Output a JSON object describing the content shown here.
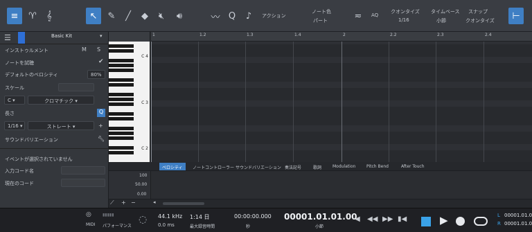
{
  "toolbar": {
    "action_label": "アクション",
    "note_color_label": "ノート色",
    "note_color_value": "パート",
    "aq_label": "AQ",
    "quantize_label": "クオンタイズ",
    "quantize_value": "1/16",
    "timebase_label": "タイムベース",
    "timebase_value": "小節",
    "snap_label": "スナップ",
    "snap_value": "クオンタイズ"
  },
  "left": {
    "kit_name": "Basic Kit",
    "instrument_label": "インストゥルメント",
    "m_label": "M",
    "s_label": "S",
    "audition_label": "ノートを試聴",
    "default_velocity_label": "デフォルトのベロシティ",
    "default_velocity_value": "80%",
    "scale_label": "スケール",
    "key_value": "C",
    "scale_value": "クロマチック",
    "length_label": "長さ",
    "length_value": "1/16",
    "length_mode": "ストレート",
    "sound_variation_label": "サウンドバリエーション",
    "no_event_label": "イベントが選択されていません",
    "input_chord_label": "入力コード名",
    "current_chord_label": "現在のコード"
  },
  "piano": {
    "c4": "C 4",
    "c3": "C 3",
    "c2": "C 2"
  },
  "ruler": {
    "ticks": [
      "1",
      "1.2",
      "1.3",
      "1.4",
      "2",
      "2.2",
      "2.3",
      "2.4"
    ]
  },
  "tabs": [
    "ベロシティ",
    "ノートコントローラー",
    "サウンドバリエーション",
    "奏法記号",
    "歌詞",
    "Modulation",
    "Pitch Bend",
    "After Touch"
  ],
  "velocity": {
    "v100": "100",
    "v50": "50.00",
    "v0": "0.00"
  },
  "transport": {
    "midi_label": "MIDI",
    "performance_label": "パフォーマンス",
    "sample_rate": "44.1 kHz",
    "latency": "0.0 ms",
    "duration": "1:14 日",
    "duration_sub": "最大録音時間",
    "time": "00:00:00.000",
    "time_unit": "秒",
    "position": "00001.01.01.00",
    "position_unit": "小節",
    "loop_l": "00001.01.01.",
    "loop_r": "00001.01.01.",
    "l_label": "L",
    "r_label": "R"
  }
}
